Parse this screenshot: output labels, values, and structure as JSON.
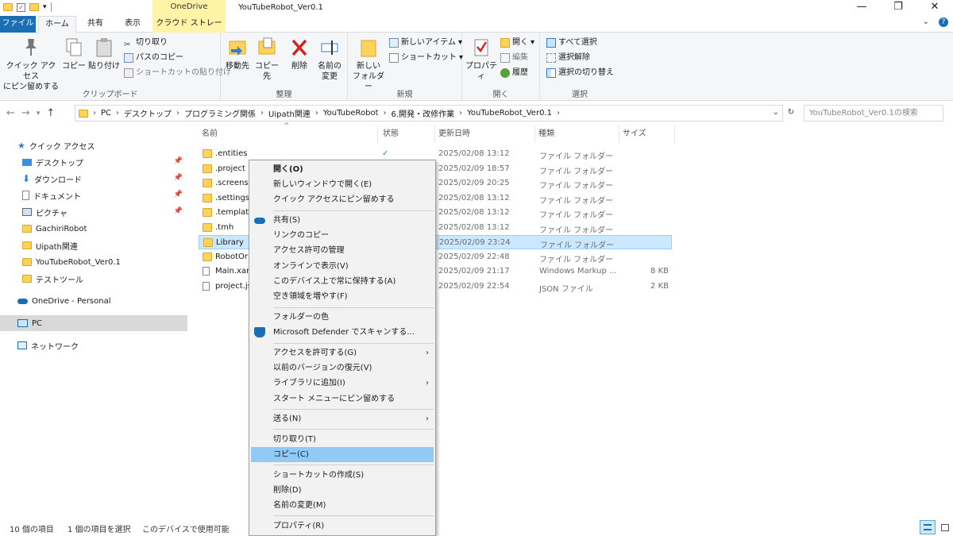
{
  "window": {
    "title": "YouTubeRobot_Ver0.1",
    "context_tab_header": "OneDrive",
    "controls": {
      "minimize": "—",
      "maximize": "❐",
      "close": "✕"
    }
  },
  "tabs": [
    {
      "label": "ファイル"
    },
    {
      "label": "ホーム"
    },
    {
      "label": "共有"
    },
    {
      "label": "表示"
    },
    {
      "label": "クラウド ストレージ"
    }
  ],
  "ribbon": {
    "clipboard": {
      "label": "クリップボード",
      "pin_quick": "クイック アクセス\nにピン留めする",
      "copy": "コピー",
      "paste": "貼り付け",
      "cut": "切り取り",
      "copy_path": "パスのコピー",
      "paste_shortcut": "ショートカットの貼り付け"
    },
    "organize": {
      "label": "整理",
      "move_to": "移動先",
      "copy_to": "コピー先",
      "delete": "削除",
      "rename": "名前の\n変更"
    },
    "new": {
      "label": "新規",
      "new_folder": "新しい\nフォルダー",
      "new_item": "新しいアイテム",
      "easy_access": "ショートカット"
    },
    "open": {
      "label": "開く",
      "properties": "プロパティ",
      "open": "開く",
      "edit": "編集",
      "history": "履歴"
    },
    "select": {
      "label": "選択",
      "select_all": "すべて選択",
      "select_none": "選択解除",
      "invert": "選択の切り替え"
    }
  },
  "address": {
    "crumbs": [
      "PC",
      "デスクトップ",
      "プログラミング関係",
      "Uipath関連",
      "YouTubeRobot",
      "6.開発・改修作業",
      "YouTubeRobot_Ver0.1"
    ],
    "search_placeholder": "YouTubeRobot_Ver0.1の検索"
  },
  "sidebar": {
    "quick_access": "クイック アクセス",
    "items": [
      {
        "label": "デスクトップ",
        "pinned": true
      },
      {
        "label": "ダウンロード",
        "pinned": true
      },
      {
        "label": "ドキュメント",
        "pinned": true
      },
      {
        "label": "ピクチャ",
        "pinned": true
      },
      {
        "label": "GachiriRobot"
      },
      {
        "label": "Uipath関連"
      },
      {
        "label": "YouTubeRobot_Ver0.1"
      },
      {
        "label": "テストツール"
      }
    ],
    "onedrive": "OneDrive - Personal",
    "pc": "PC",
    "network": "ネットワーク"
  },
  "columns": {
    "name": "名前",
    "status": "状態",
    "date": "更新日時",
    "type": "種類",
    "size": "サイズ"
  },
  "files": [
    {
      "name": ".entities",
      "status": "✓",
      "date": "2025/02/08 13:12",
      "type": "ファイル フォルダー",
      "size": ""
    },
    {
      "name": ".project",
      "status": "",
      "date": "2025/02/09 18:57",
      "type": "ファイル フォルダー",
      "size": ""
    },
    {
      "name": ".screensh",
      "status": "",
      "date": "2025/02/09 20:25",
      "type": "ファイル フォルダー",
      "size": ""
    },
    {
      "name": ".settings",
      "status": "",
      "date": "2025/02/08 13:12",
      "type": "ファイル フォルダー",
      "size": ""
    },
    {
      "name": ".template",
      "status": "",
      "date": "2025/02/08 13:12",
      "type": "ファイル フォルダー",
      "size": ""
    },
    {
      "name": ".tmh",
      "status": "",
      "date": "2025/02/08 13:12",
      "type": "ファイル フォルダー",
      "size": ""
    },
    {
      "name": "Library",
      "status": "",
      "date": "2025/02/09 23:24",
      "type": "ファイル フォルダー",
      "size": ""
    },
    {
      "name": "RobotOri",
      "status": "",
      "date": "2025/02/09 22:48",
      "type": "ファイル フォルダー",
      "size": ""
    },
    {
      "name": "Main.xam",
      "status": "",
      "date": "2025/02/09 21:17",
      "type": "Windows Markup ...",
      "size": "8 KB"
    },
    {
      "name": "project.js",
      "status": "",
      "date": "2025/02/09 22:54",
      "type": "JSON ファイル",
      "size": "2 KB"
    }
  ],
  "context_menu": [
    {
      "label": "開く(O)",
      "bold": true
    },
    {
      "label": "新しいウィンドウで開く(E)"
    },
    {
      "label": "クイック アクセスにピン留めする"
    },
    {
      "sep": true
    },
    {
      "label": "共有(S)",
      "icon": "onedrive"
    },
    {
      "label": "リンクのコピー"
    },
    {
      "label": "アクセス許可の管理"
    },
    {
      "label": "オンラインで表示(V)"
    },
    {
      "label": "このデバイス上で常に保持する(A)"
    },
    {
      "label": "空き領域を増やす(F)"
    },
    {
      "sep": true
    },
    {
      "label": "フォルダーの色"
    },
    {
      "label": "Microsoft Defender でスキャンする...",
      "icon": "defender"
    },
    {
      "sep": true
    },
    {
      "label": "アクセスを許可する(G)",
      "sub": true
    },
    {
      "label": "以前のバージョンの復元(V)"
    },
    {
      "label": "ライブラリに追加(I)",
      "sub": true
    },
    {
      "label": "スタート メニューにピン留めする"
    },
    {
      "sep": true
    },
    {
      "label": "送る(N)",
      "sub": true
    },
    {
      "sep": true
    },
    {
      "label": "切り取り(T)"
    },
    {
      "label": "コピー(C)",
      "highlight": true
    },
    {
      "sep": true
    },
    {
      "label": "ショートカットの作成(S)"
    },
    {
      "label": "削除(D)"
    },
    {
      "label": "名前の変更(M)"
    },
    {
      "sep": true
    },
    {
      "label": "プロパティ(R)"
    }
  ],
  "status": {
    "count": "10 個の項目",
    "selected": "1 個の項目を選択",
    "availability": "このデバイスで使用可能"
  },
  "colors": {
    "accent": "#1a6fb4",
    "selection": "#cce8ff",
    "menu_highlight": "#91c9f7",
    "folder": "#ffd35a"
  }
}
